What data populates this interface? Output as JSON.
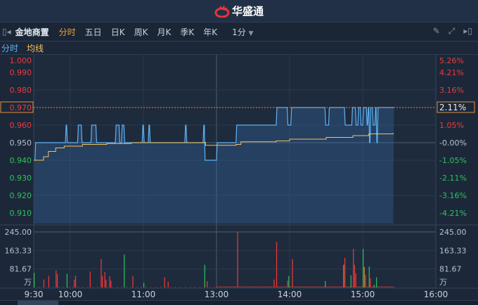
{
  "app": {
    "title": "华盛通",
    "logo_icon": "flame-logo-icon"
  },
  "toolbar": {
    "stock_name": "金地商置",
    "periods": [
      "分时",
      "五日",
      "日K",
      "周K",
      "月K",
      "季K",
      "年K"
    ],
    "active_period": "分时",
    "interval": "1分",
    "icons": [
      "pencil-icon",
      "fullscreen-icon",
      "collapse-right-icon"
    ]
  },
  "legend": {
    "price_label": "分时",
    "avg_label": "均线"
  },
  "colors": {
    "price_line": "#5cb3f5",
    "avg_line": "#f2c15a",
    "up": "#f0393a",
    "down": "#2ec25b",
    "flat": "#c89030",
    "accent": "#e0903a"
  },
  "price_axis": {
    "labels": [
      "1.000",
      "0.990",
      "0.980",
      "0.970",
      "0.960",
      "0.950",
      "0.940",
      "0.930",
      "0.920",
      "0.910"
    ],
    "values": [
      1.0,
      0.99,
      0.98,
      0.97,
      0.96,
      0.95,
      0.94,
      0.93,
      0.92,
      0.91
    ],
    "pct_labels": [
      "5.26%",
      "4.21%",
      "3.16%",
      "2.11%",
      "1.05%",
      "-0.00%",
      "-1.05%",
      "-2.11%",
      "-3.16%",
      "-4.21%"
    ],
    "current_price": "0.970",
    "current_pct": "2.11%",
    "prev_close": 0.95
  },
  "volume_axis": {
    "labels": [
      "245.00",
      "163.33",
      "81.67"
    ],
    "values": [
      245,
      163.33,
      81.67
    ],
    "unit": "万"
  },
  "time_axis": {
    "labels": [
      "9:30",
      "10:00",
      "11:00",
      "13:00",
      "14:00",
      "15:00",
      "16:00"
    ],
    "minutes": [
      0,
      30,
      90,
      150,
      210,
      270,
      330
    ]
  },
  "chart_data": {
    "type": "line",
    "price_series": [
      [
        0,
        0.94
      ],
      [
        1,
        0.95
      ],
      [
        26,
        0.96
      ],
      [
        27,
        0.95
      ],
      [
        36,
        0.96
      ],
      [
        39,
        0.95
      ],
      [
        47,
        0.96
      ],
      [
        51,
        0.95
      ],
      [
        67,
        0.96
      ],
      [
        70,
        0.95
      ],
      [
        72,
        0.96
      ],
      [
        74,
        0.95
      ],
      [
        89,
        0.96
      ],
      [
        90,
        0.95
      ],
      [
        94,
        0.96
      ],
      [
        95,
        0.95
      ],
      [
        124,
        0.96
      ],
      [
        125,
        0.95
      ],
      [
        139,
        0.96
      ],
      [
        140,
        0.94
      ],
      [
        150,
        0.95
      ],
      [
        166,
        0.96
      ],
      [
        199,
        0.97
      ],
      [
        208,
        0.96
      ],
      [
        211,
        0.97
      ],
      [
        239,
        0.96
      ],
      [
        242,
        0.97
      ],
      [
        255,
        0.96
      ],
      [
        261,
        0.97
      ],
      [
        264,
        0.96
      ],
      [
        266,
        0.97
      ],
      [
        268,
        0.96
      ],
      [
        270,
        0.97
      ],
      [
        273,
        0.96
      ],
      [
        274,
        0.97
      ],
      [
        275,
        0.95
      ],
      [
        276,
        0.97
      ],
      [
        278,
        0.96
      ],
      [
        280,
        0.97
      ],
      [
        281,
        0.95
      ],
      [
        282,
        0.97
      ],
      [
        295,
        0.97
      ]
    ],
    "avg_series": [
      [
        0,
        0.94
      ],
      [
        8,
        0.942
      ],
      [
        12,
        0.945
      ],
      [
        18,
        0.947
      ],
      [
        25,
        0.948
      ],
      [
        40,
        0.949
      ],
      [
        60,
        0.9495
      ],
      [
        80,
        0.95
      ],
      [
        140,
        0.9502
      ],
      [
        141,
        0.9485
      ],
      [
        166,
        0.949
      ],
      [
        170,
        0.9505
      ],
      [
        199,
        0.951
      ],
      [
        210,
        0.952
      ],
      [
        240,
        0.953
      ],
      [
        262,
        0.954
      ],
      [
        275,
        0.955
      ],
      [
        295,
        0.9555
      ]
    ],
    "volume_bars": [
      [
        0,
        64,
        "d"
      ],
      [
        8,
        35,
        "u"
      ],
      [
        12,
        50,
        "u"
      ],
      [
        18,
        75,
        "u"
      ],
      [
        19,
        60,
        "u"
      ],
      [
        27,
        60,
        "d"
      ],
      [
        33,
        35,
        "u"
      ],
      [
        34,
        52,
        "u"
      ],
      [
        46,
        70,
        "u"
      ],
      [
        55,
        125,
        "u"
      ],
      [
        56,
        50,
        "u"
      ],
      [
        58,
        68,
        "u"
      ],
      [
        59,
        35,
        "u"
      ],
      [
        62,
        50,
        "u"
      ],
      [
        63,
        30,
        "u"
      ],
      [
        74,
        145,
        "d"
      ],
      [
        81,
        50,
        "u"
      ],
      [
        90,
        20,
        "d"
      ],
      [
        107,
        45,
        "u"
      ],
      [
        110,
        25,
        "u"
      ],
      [
        140,
        100,
        "d"
      ],
      [
        142,
        28,
        "u"
      ],
      [
        167,
        245,
        "u"
      ],
      [
        197,
        35,
        "u"
      ],
      [
        199,
        200,
        "u"
      ],
      [
        208,
        30,
        "u"
      ],
      [
        209,
        50,
        "d"
      ],
      [
        212,
        125,
        "u"
      ],
      [
        239,
        28,
        "d"
      ],
      [
        254,
        100,
        "f"
      ],
      [
        255,
        130,
        "u"
      ],
      [
        260,
        53,
        "d"
      ],
      [
        262,
        170,
        "u"
      ],
      [
        263,
        100,
        "u"
      ],
      [
        264,
        63,
        "u"
      ],
      [
        270,
        170,
        "d"
      ],
      [
        271,
        90,
        "f"
      ],
      [
        272,
        55,
        "u"
      ],
      [
        275,
        92,
        "d"
      ],
      [
        276,
        40,
        "u"
      ],
      [
        279,
        12,
        "d"
      ],
      [
        281,
        45,
        "d"
      ]
    ],
    "baseline_volume": 4,
    "xlabel": "",
    "ylabel": ""
  }
}
